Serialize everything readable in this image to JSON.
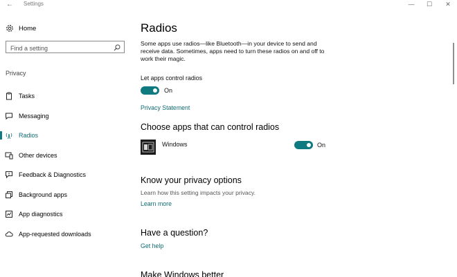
{
  "window": {
    "title": "Settings",
    "back_glyph": "←",
    "minimize_glyph": "—",
    "maximize_glyph": "☐",
    "close_glyph": "✕"
  },
  "sidebar": {
    "home_label": "Home",
    "home_icon": "gear-icon",
    "search_placeholder": "Find a setting",
    "section_label": "Privacy",
    "items": [
      {
        "label": "Tasks",
        "icon": "clipboard-icon",
        "active": false
      },
      {
        "label": "Messaging",
        "icon": "chat-icon",
        "active": false
      },
      {
        "label": "Radios",
        "icon": "radio-tower-icon",
        "active": true
      },
      {
        "label": "Other devices",
        "icon": "devices-icon",
        "active": false
      },
      {
        "label": "Feedback & Diagnostics",
        "icon": "feedback-icon",
        "active": false
      },
      {
        "label": "Background apps",
        "icon": "background-apps-icon",
        "active": false
      },
      {
        "label": "App diagnostics",
        "icon": "diagnostics-icon",
        "active": false
      },
      {
        "label": "App-requested downloads",
        "icon": "cloud-icon",
        "active": false
      }
    ]
  },
  "main": {
    "title": "Radios",
    "description": "Some apps use radios—like Bluetooth—in your device to send and receive data. Sometimes, apps need to turn these radios on and off to work their magic.",
    "master_toggle": {
      "label": "Let apps control radios",
      "state": "On"
    },
    "privacy_link": "Privacy Statement",
    "apps_heading": "Choose apps that can control radios",
    "apps": [
      {
        "name": "Windows",
        "state": "On",
        "icon": "windows-app-icon"
      }
    ],
    "privacy_options": {
      "heading": "Know your privacy options",
      "sub": "Learn how this setting impacts your privacy.",
      "link": "Learn more"
    },
    "question": {
      "heading": "Have a question?",
      "link": "Get help"
    },
    "better_heading": "Make Windows better"
  },
  "colors": {
    "accent": "#0f7b81",
    "link": "#0f6b73"
  }
}
